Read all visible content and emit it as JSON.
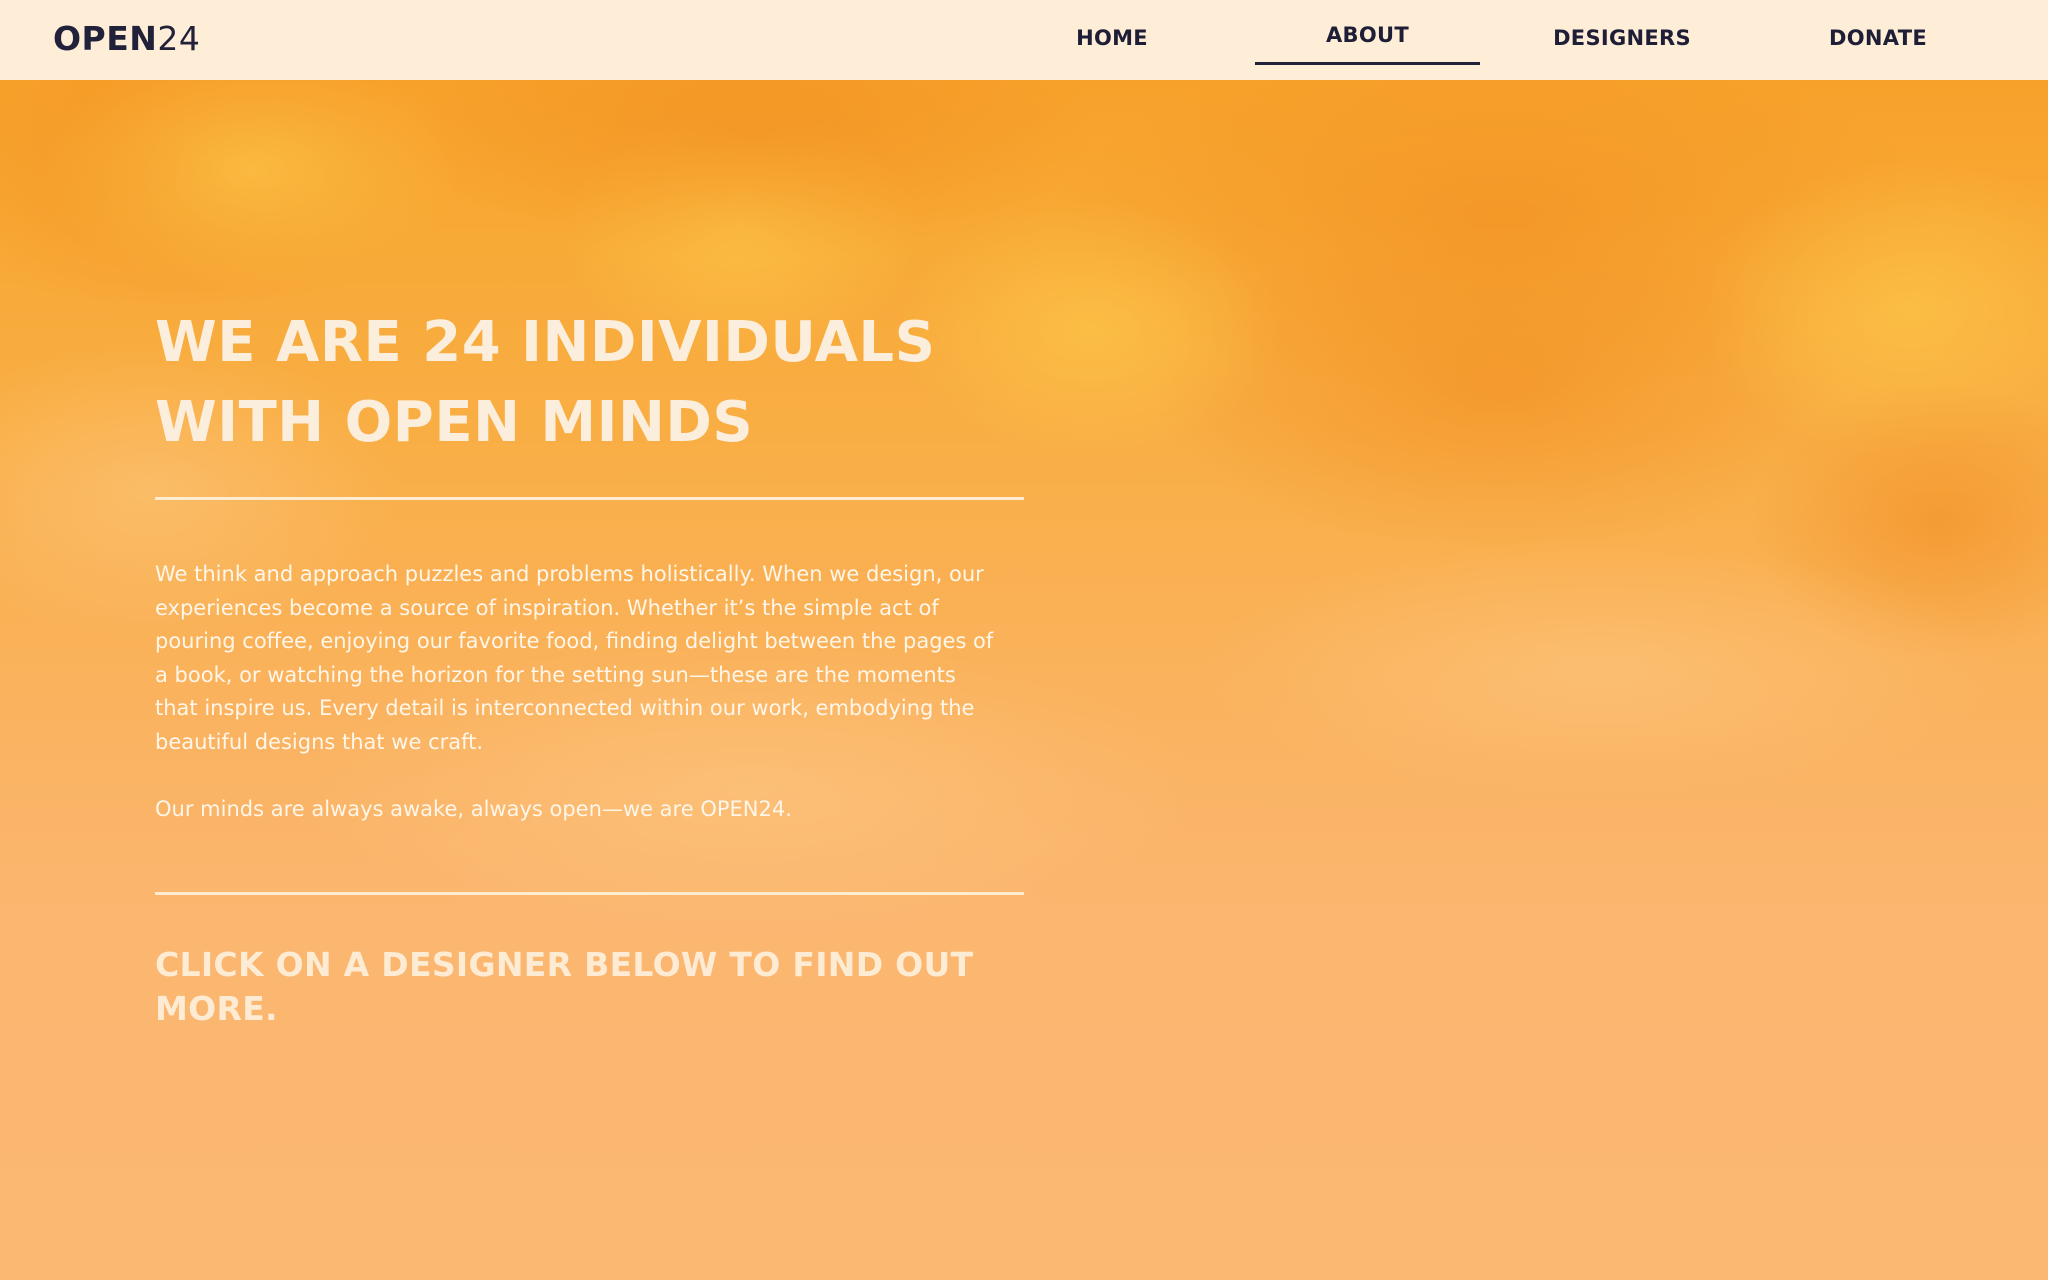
{
  "nav": {
    "logo_bold": "OPEN",
    "logo_light": "24",
    "items": [
      {
        "label": "HOME"
      },
      {
        "label": "ABOUT",
        "active": true
      },
      {
        "label": "DESIGNERS"
      },
      {
        "label": "DONATE"
      }
    ]
  },
  "hero": {
    "headline": "WE ARE 24 INDIVIDUALS WITH OPEN MINDS",
    "paragraph_1": "We think and approach puzzles and problems holistically. When we design, our experiences become a source of inspiration. Whether it’s the simple act of pouring coffee, enjoying our favorite food, finding delight between the pages of a book, or watching the horizon for the setting sun—these are the moments that inspire us. Every detail is interconnected within our work, embodying the beautiful designs that we craft.",
    "paragraph_2": "Our minds are always awake, always open—we are OPEN24.",
    "cta": "CLICK ON A DESIGNER BELOW TO FIND OUT MORE."
  },
  "colors": {
    "nav_background": "#FEEED8",
    "nav_text": "#1E1E36",
    "sky_top": "#F7A12A",
    "sky_bottom": "#FBB872",
    "hero_text": "#FCEEDC"
  }
}
